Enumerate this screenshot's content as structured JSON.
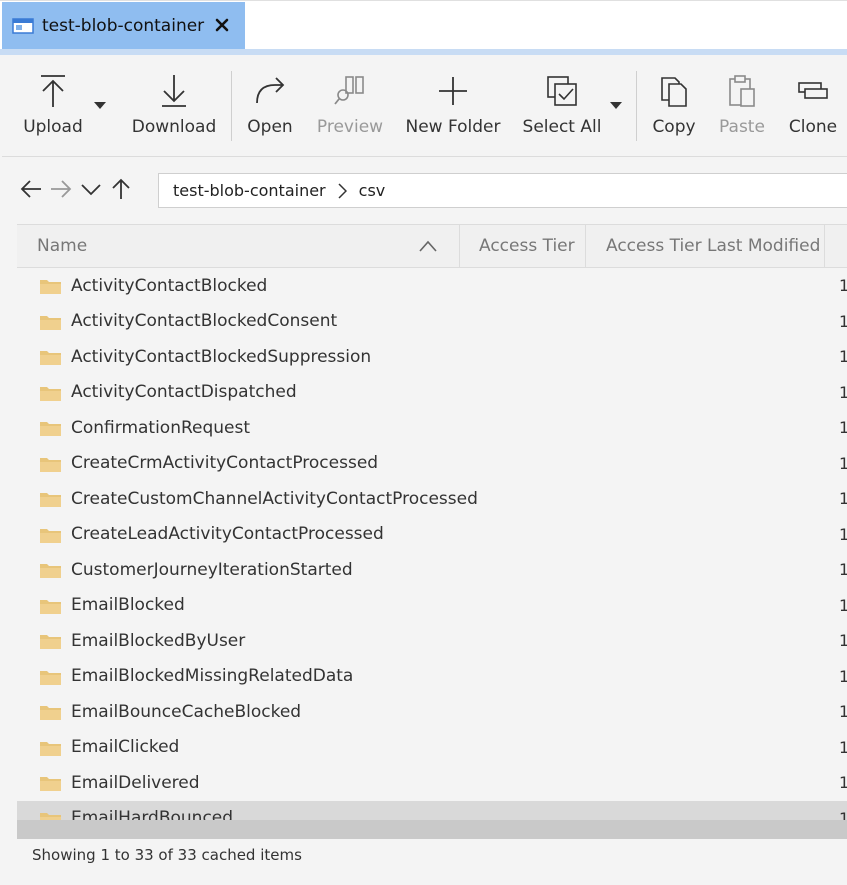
{
  "tab": {
    "title": "test-blob-container"
  },
  "toolbar": {
    "upload": "Upload",
    "download": "Download",
    "open": "Open",
    "preview": "Preview",
    "new_folder": "New Folder",
    "select_all": "Select All",
    "copy": "Copy",
    "paste": "Paste",
    "clone": "Clone"
  },
  "address": {
    "segments": [
      "test-blob-container",
      "csv"
    ]
  },
  "columns": {
    "name": "Name",
    "access_tier": "Access Tier",
    "access_tier_modified": "Access Tier Last Modified"
  },
  "rows": [
    "ActivityContactBlocked",
    "ActivityContactBlockedConsent",
    "ActivityContactBlockedSuppression",
    "ActivityContactDispatched",
    "ConfirmationRequest",
    "CreateCrmActivityContactProcessed",
    "CreateCustomChannelActivityContactProcessed",
    "CreateLeadActivityContactProcessed",
    "CustomerJourneyIterationStarted",
    "EmailBlocked",
    "EmailBlockedByUser",
    "EmailBlockedMissingRelatedData",
    "EmailBounceCacheBlocked",
    "EmailClicked",
    "EmailDelivered",
    "EmailHardBounced"
  ],
  "row_trailing_text": "1",
  "status": "Showing 1 to 33 of 33 cached items",
  "colors": {
    "tab_active": "#8fbdf0",
    "folder": "#e8c57a",
    "accent": "#c8dcf4"
  }
}
